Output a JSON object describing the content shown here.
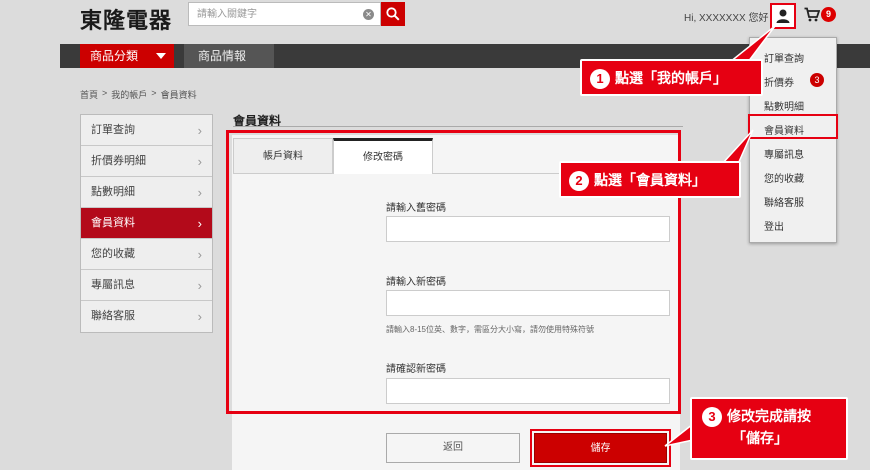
{
  "header": {
    "logo": "東隆電器",
    "search_placeholder": "請輸入關鍵字",
    "greeting": "Hi, XXXXXXX 您好",
    "cart_count": "9"
  },
  "nav": {
    "category": "商品分類",
    "info": "商品情報"
  },
  "breadcrumb": [
    "首頁",
    ">",
    "我的帳戶",
    ">",
    "會員資料"
  ],
  "sidebar": {
    "items": [
      {
        "label": "訂單查詢"
      },
      {
        "label": "折價券明細"
      },
      {
        "label": "點數明細"
      },
      {
        "label": "會員資料"
      },
      {
        "label": "您的收藏"
      },
      {
        "label": "專屬訊息"
      },
      {
        "label": "聯絡客服"
      }
    ]
  },
  "main": {
    "title": "會員資料",
    "tabs": [
      {
        "label": "帳戶資料"
      },
      {
        "label": "修改密碼"
      }
    ],
    "old_password_label": "請輸入舊密碼",
    "new_password_label": "請輸入新密碼",
    "hint": "請輸入8-15位英、數字，需區分大小寫，請勿使用特殊符號",
    "confirm_password_label": "請確認新密碼",
    "back_label": "返回",
    "save_label": "儲存"
  },
  "dropdown": {
    "items": [
      {
        "label": "訂單查詢"
      },
      {
        "label": "折價券"
      },
      {
        "label": "點數明細"
      },
      {
        "label": "會員資料"
      },
      {
        "label": "專屬訊息"
      },
      {
        "label": "您的收藏"
      },
      {
        "label": "聯絡客服"
      },
      {
        "label": "登出"
      }
    ],
    "coupon_badge": "3"
  },
  "callouts": {
    "step1": {
      "num": "1",
      "text": "點選「我的帳戶」"
    },
    "step2": {
      "num": "2",
      "text": "點選「會員資料」"
    },
    "step3": {
      "num": "3",
      "line1": "修改完成請按",
      "line2": "「儲存」"
    }
  },
  "colors": {
    "brand_red": "#e60012",
    "active_red": "#b30a1a",
    "nav_dark": "#3a3a3a"
  }
}
